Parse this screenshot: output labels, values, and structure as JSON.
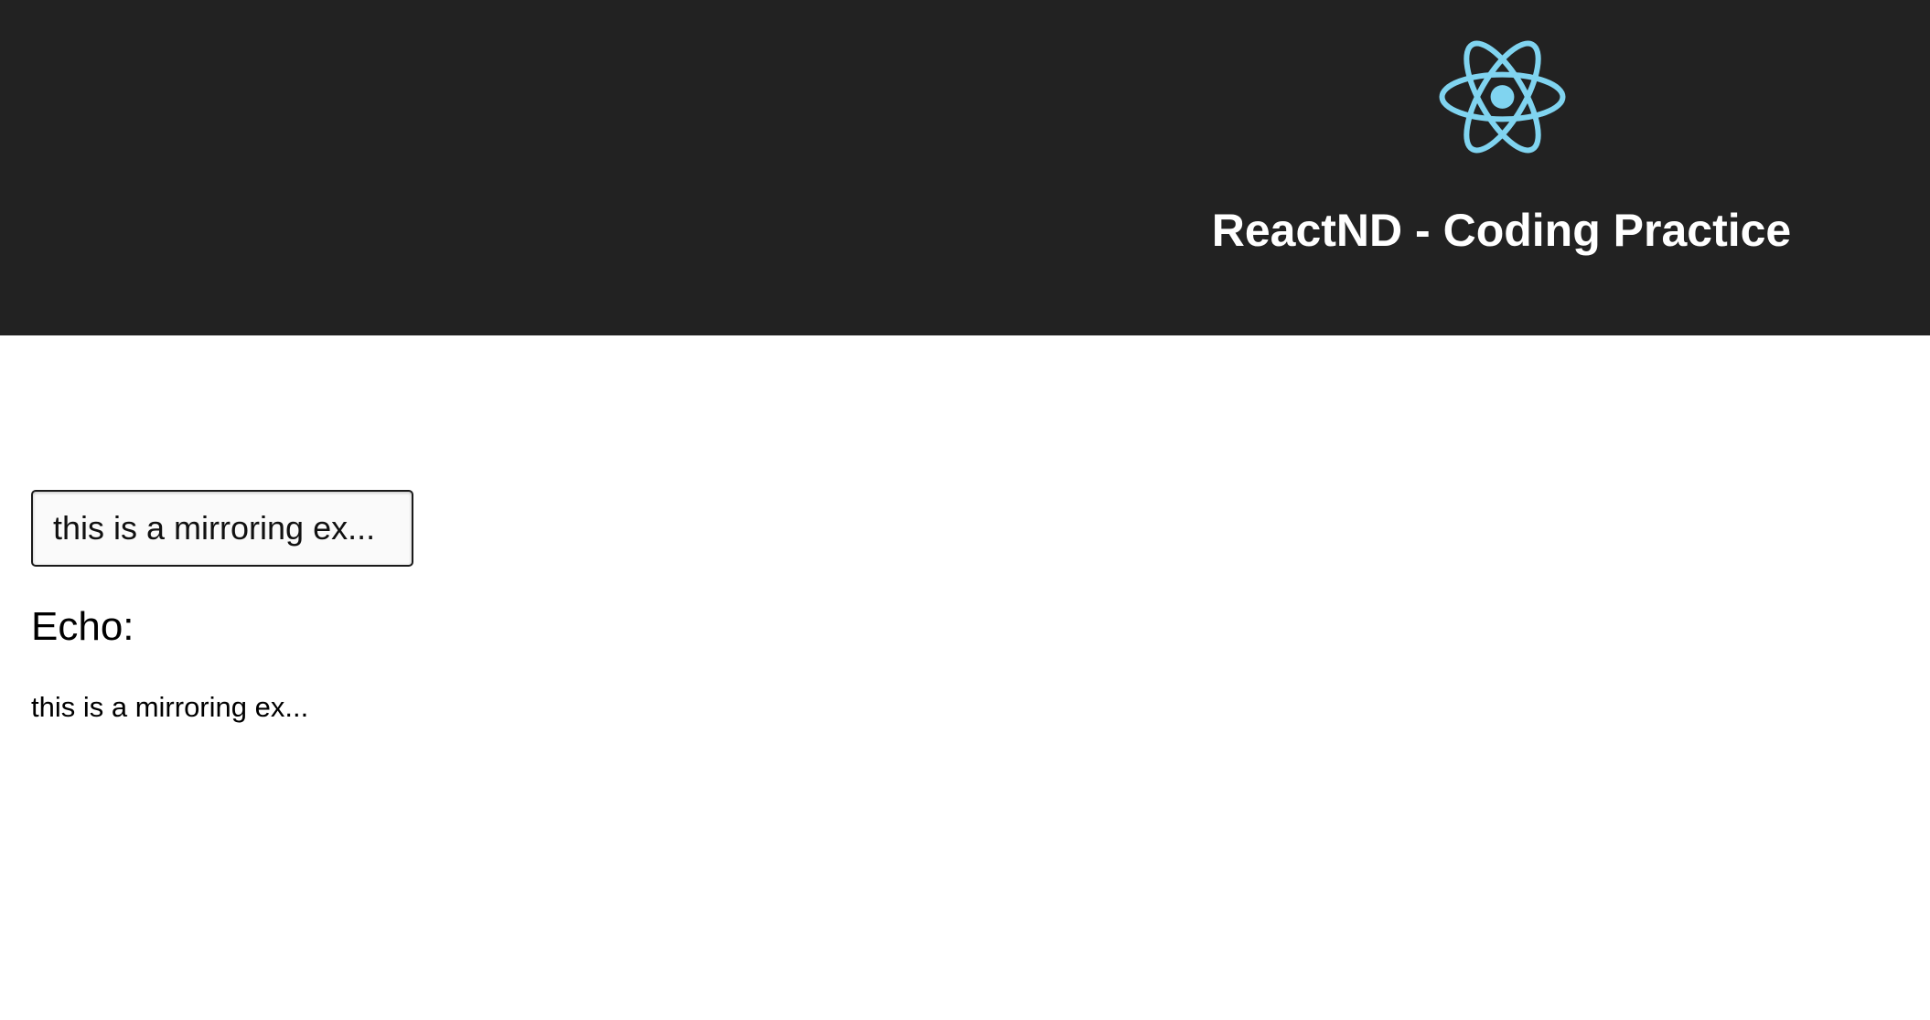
{
  "header": {
    "title": "ReactND - Coding Practice",
    "logo_icon": "react-atom-icon",
    "background_color": "#222222",
    "logo_color": "#80d4f0"
  },
  "main": {
    "input": {
      "value": "this is a mirroring ex...",
      "placeholder": ""
    },
    "echo_heading": "Echo:",
    "echo_text": "this is a mirroring ex..."
  }
}
